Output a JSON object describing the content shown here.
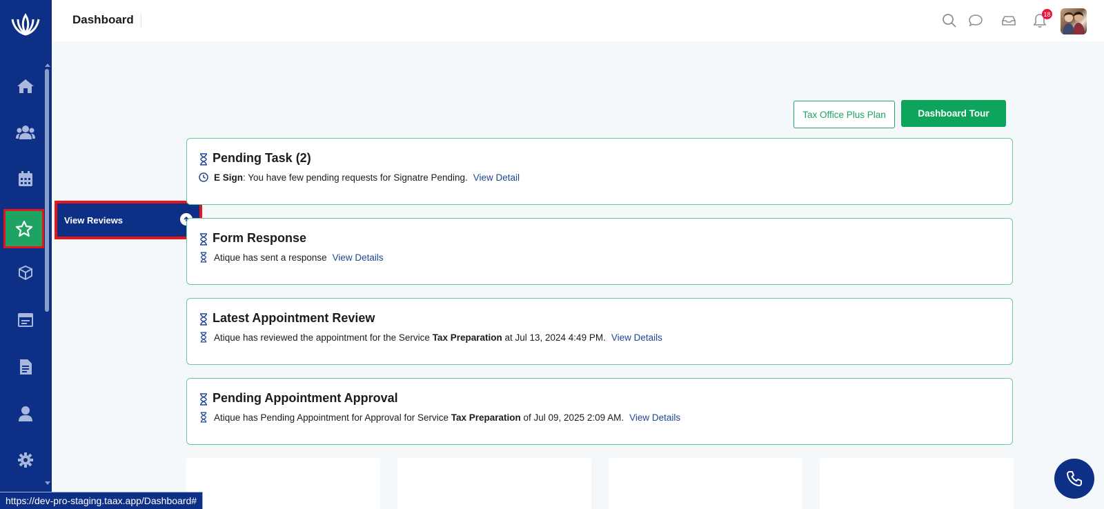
{
  "topbar": {
    "title": "Dashboard",
    "notification_count": "18",
    "icons": [
      "search-icon",
      "chat-icon",
      "inbox-icon",
      "bell-icon"
    ]
  },
  "sidebar": {
    "items": [
      {
        "icon": "home-icon"
      },
      {
        "icon": "users-icon"
      },
      {
        "icon": "calendar-icon"
      },
      {
        "icon": "star-icon",
        "active": true
      },
      {
        "icon": "box-icon"
      },
      {
        "icon": "calendar-check-icon"
      },
      {
        "icon": "document-icon"
      },
      {
        "icon": "user-icon"
      },
      {
        "icon": "gear-icon"
      }
    ],
    "flyout": {
      "label": "View Reviews"
    }
  },
  "actions": {
    "plan_label": "Tax Office Plus Plan",
    "tour_label": "Dashboard Tour"
  },
  "cards": [
    {
      "title": "Pending Task (2)",
      "prefix_bold": "E Sign",
      "text": ": You have few pending requests for Signatre Pending.",
      "link": "View Detail"
    },
    {
      "title": "Form Response",
      "text": "Atique has sent a response",
      "link": "View Details"
    },
    {
      "title": "Latest Appointment Review",
      "text_a": "Atique has reviewed the appointment for the Service ",
      "bold": "Tax Preparation",
      "text_b": " at Jul 13, 2024 4:49 PM.",
      "link": "View Details"
    },
    {
      "title": "Pending Appointment Approval",
      "text_a": "Atique has Pending Appointment for Approval for Service ",
      "bold": "Tax Preparation",
      "text_b": " of Jul 09, 2025 2:09 AM.",
      "link": "View Details"
    }
  ],
  "statusbar": {
    "url": "https://dev-pro-staging.taax.app/Dashboard#"
  },
  "colors": {
    "sidebar": "#0d2f86",
    "accent": "#1da463",
    "highlight": "#e8141c"
  }
}
